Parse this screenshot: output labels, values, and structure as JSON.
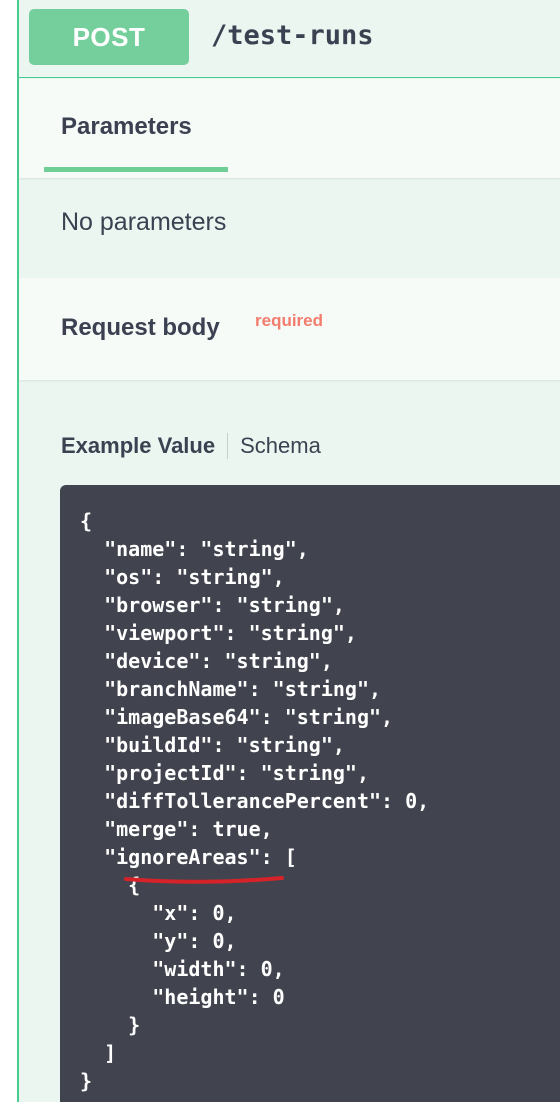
{
  "operation": {
    "method": "POST",
    "path": "/test-runs"
  },
  "parameters": {
    "tab_label": "Parameters",
    "empty_text": "No parameters"
  },
  "request_body": {
    "title": "Request body",
    "required_label": "required"
  },
  "example_tabs": {
    "example_label": "Example Value",
    "schema_label": "Schema"
  },
  "example_lines": [
    "{",
    "  \"name\": \"string\",",
    "  \"os\": \"string\",",
    "  \"browser\": \"string\",",
    "  \"viewport\": \"string\",",
    "  \"device\": \"string\",",
    "  \"branchName\": \"string\",",
    "  \"imageBase64\": \"string\",",
    "  \"buildId\": \"string\",",
    "  \"projectId\": \"string\",",
    "  \"diffTollerancePercent\": 0,",
    "  \"merge\": true,",
    "  \"ignoreAreas\": [",
    "    {",
    "      \"x\": 0,",
    "      \"y\": 0,",
    "      \"width\": 0,",
    "      \"height\": 0",
    "    }",
    "  ]",
    "}"
  ],
  "colors": {
    "post_green": "#49cc90",
    "required_red": "#f27d6e",
    "code_bg": "#41444e",
    "annotation_red": "#d6232a"
  }
}
